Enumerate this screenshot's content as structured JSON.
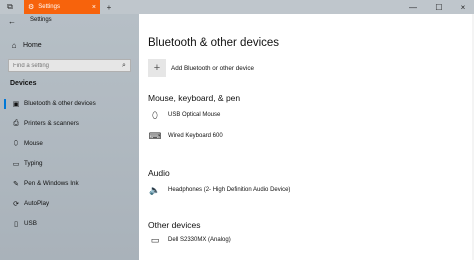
{
  "tabbar": {
    "nav_icon": "⧉",
    "tab_title": "Settings",
    "tab_icon": "⚙",
    "tab_close": "×",
    "new_tab": "+",
    "minimize": "—",
    "maximize": "☐",
    "close": "×",
    "accent": "#f7630c"
  },
  "sidebar": {
    "back": "←",
    "app_title": "Settings",
    "home": "Home",
    "home_icon": "⌂",
    "search_placeholder": "Find a setting",
    "search_icon": "⌕",
    "section": "Devices",
    "items": [
      {
        "label": "Bluetooth & other devices",
        "icon": "▣"
      },
      {
        "label": "Printers & scanners",
        "icon": "⎙"
      },
      {
        "label": "Mouse",
        "icon": "⬯"
      },
      {
        "label": "Typing",
        "icon": "▭"
      },
      {
        "label": "Pen & Windows Ink",
        "icon": "✎"
      },
      {
        "label": "AutoPlay",
        "icon": "⟳"
      },
      {
        "label": "USB",
        "icon": "▯"
      }
    ]
  },
  "main": {
    "title": "Bluetooth & other devices",
    "add_icon": "+",
    "add_label": "Add Bluetooth or other device",
    "groups": [
      {
        "heading": "Mouse, keyboard, & pen",
        "devices": [
          {
            "label": "USB Optical Mouse",
            "icon": "⬯"
          },
          {
            "label": "Wired Keyboard 600",
            "icon": "⌨"
          }
        ]
      },
      {
        "heading": "Audio",
        "devices": [
          {
            "label": "Headphones (2- High Definition Audio Device)",
            "icon": "🔈"
          }
        ]
      },
      {
        "heading": "Other devices",
        "devices": [
          {
            "label": "Dell S2330MX (Analog)",
            "icon": "▭"
          }
        ]
      }
    ]
  }
}
